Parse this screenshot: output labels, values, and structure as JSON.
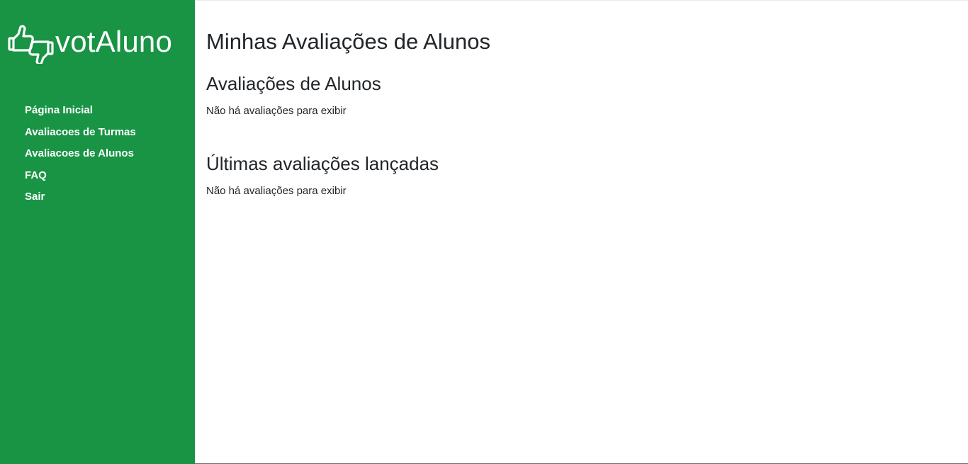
{
  "sidebar": {
    "logo_text": "votAluno",
    "logo_icon": "thumbs-up-down-icon",
    "items": [
      {
        "label": "Página Inicial"
      },
      {
        "label": "Avaliacoes de Turmas"
      },
      {
        "label": "Avaliacoes de Alunos"
      },
      {
        "label": "FAQ"
      },
      {
        "label": "Sair"
      }
    ]
  },
  "main": {
    "title": "Minhas Avaliações de Alunos",
    "sections": [
      {
        "title": "Avaliações de Alunos",
        "empty_text": "Não há avaliações para exibir"
      },
      {
        "title": "Últimas avaliações lançadas",
        "empty_text": "Não há avaliações para exibir"
      }
    ]
  },
  "colors": {
    "sidebar_bg": "#189444",
    "sidebar_text": "#ffffff",
    "body_text": "#212529"
  }
}
